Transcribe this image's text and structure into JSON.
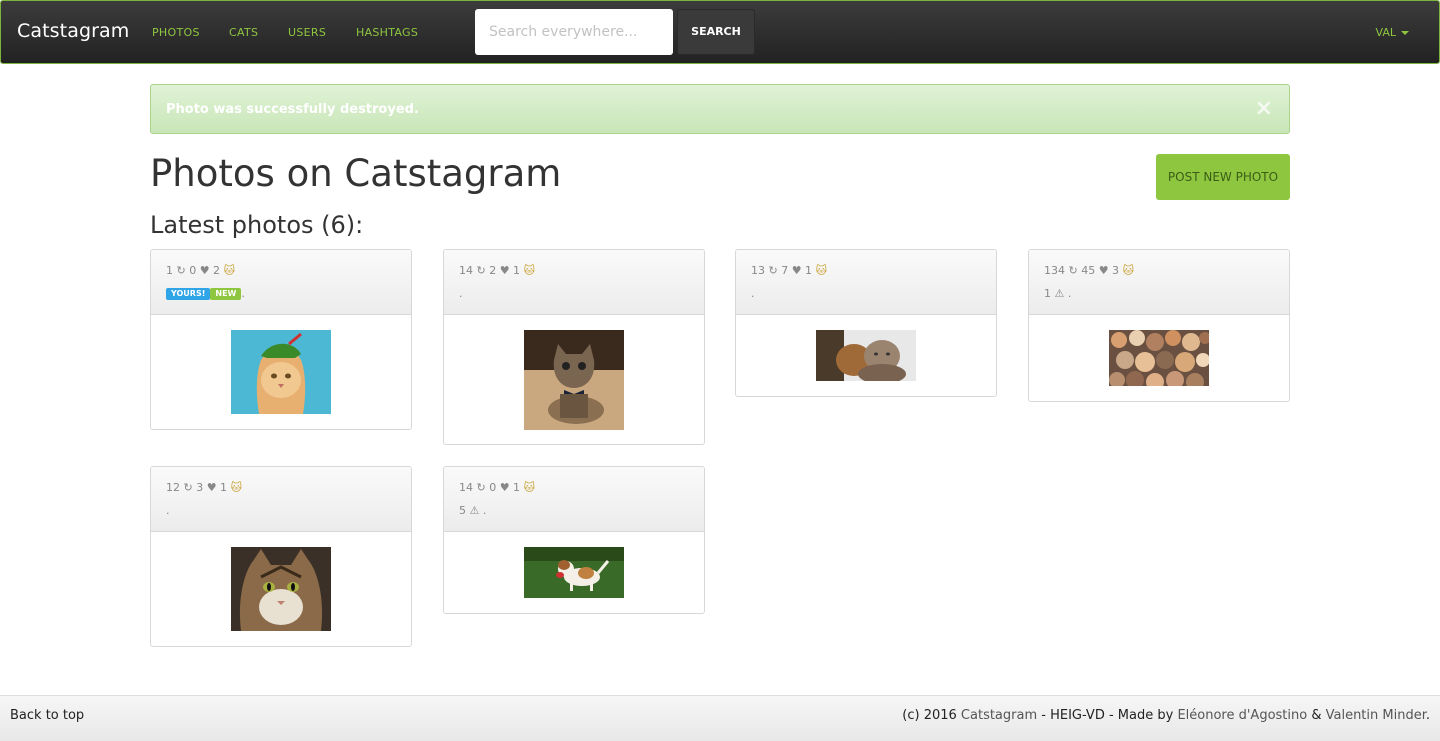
{
  "navbar": {
    "brand": "Catstagram",
    "links": [
      "PHOTOS",
      "CATS",
      "USERS",
      "HASHTAGS"
    ],
    "search_placeholder": "Search everywhere...",
    "search_button": "SEARCH",
    "user": "VAL",
    "accent_color": "#8ec640"
  },
  "alert": {
    "message": "Photo was successfully destroyed.",
    "close": "×"
  },
  "main": {
    "title": "Photos on Catstagram",
    "subtitle": "Latest photos (6):",
    "post_button": "POST NEW PHOTO"
  },
  "photos": [
    {
      "stats": "1 ↻ 0 ♥ 2",
      "cat": "🐱",
      "badges": [
        "YOURS!",
        "NEW"
      ],
      "line2": ".",
      "image": "cat-with-hat"
    },
    {
      "stats": "14 ↻ 2 ♥ 1",
      "cat": "🐱",
      "line2": ".",
      "image": "kitten-bowtie"
    },
    {
      "stats": "13 ↻ 7 ♥ 1",
      "cat": "🐱",
      "line2": ".",
      "image": "two-cats"
    },
    {
      "stats": "134 ↻ 45 ♥ 3",
      "cat": "🐱",
      "line2": "1 ⚠ .",
      "image": "many-cats"
    },
    {
      "stats": "12 ↻ 3 ♥ 1",
      "cat": "🐱",
      "line2": ".",
      "image": "tabby-face"
    },
    {
      "stats": "14 ↻ 0 ♥ 1",
      "cat": "🐱",
      "line2": "5 ⚠ .",
      "image": "beagle-puppy"
    }
  ],
  "footer": {
    "back_to_top": "Back to top",
    "credits_prefix": "(c) 2016 ",
    "credits_site": "Catstagram",
    "credits_mid": " - HEIG-VD - Made by ",
    "author1": "Eléonore d'Agostino",
    "amp": " & ",
    "author2": "Valentin Minder",
    "credits_end": "."
  }
}
